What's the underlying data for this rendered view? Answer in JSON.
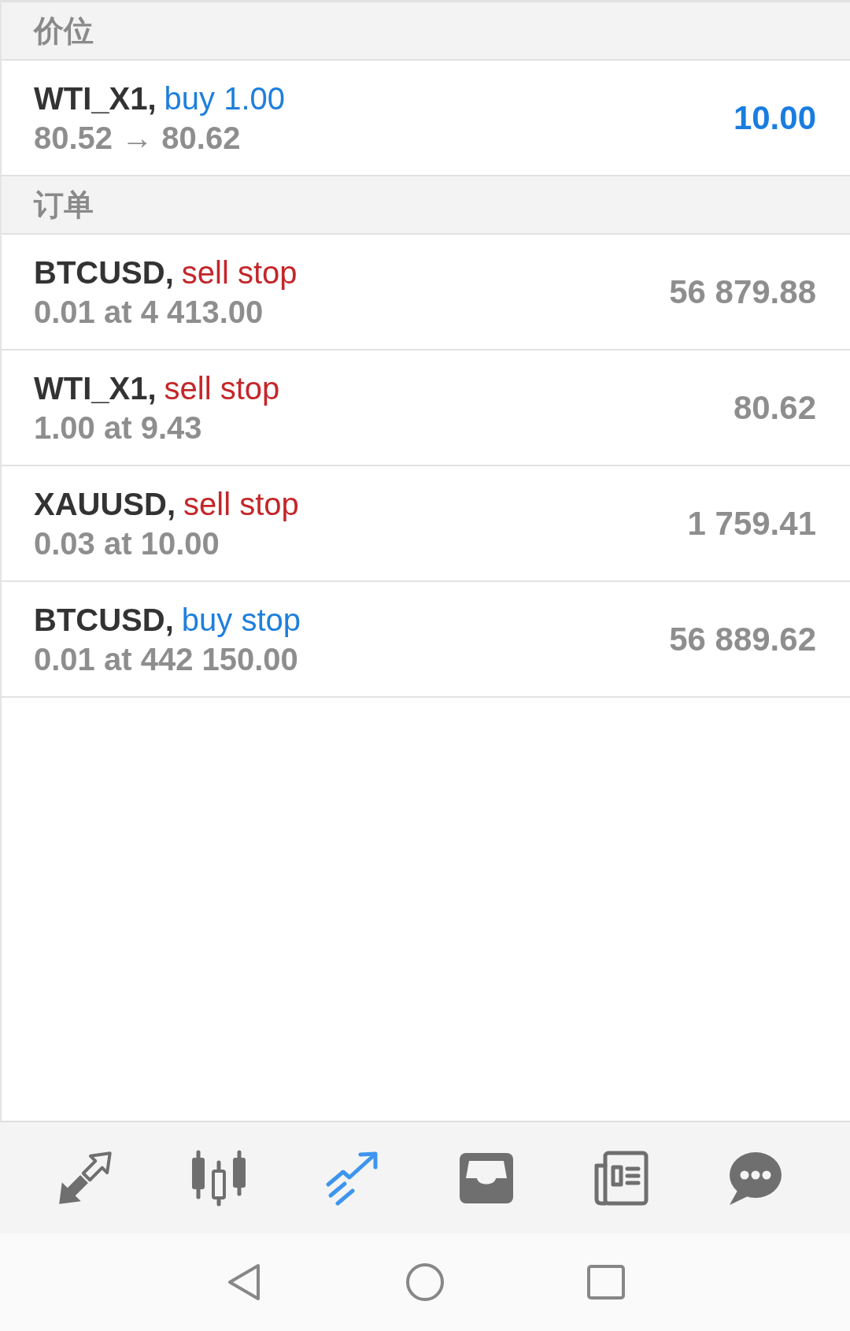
{
  "sections": [
    {
      "title": "价位",
      "items": [
        {
          "symbol": "WTI_X1,",
          "type": "buy 1.00",
          "kind": "buy",
          "detail": "80.52 → 80.62",
          "value": "10.00",
          "highlighted": true
        }
      ]
    },
    {
      "title": "订单",
      "items": [
        {
          "symbol": "BTCUSD,",
          "type": "sell stop",
          "kind": "sell",
          "detail": "0.01 at 4 413.00",
          "value": "56 879.88",
          "highlighted": false
        },
        {
          "symbol": "WTI_X1,",
          "type": "sell stop",
          "kind": "sell",
          "detail": "1.00 at 9.43",
          "value": "80.62",
          "highlighted": false
        },
        {
          "symbol": "XAUUSD,",
          "type": "sell stop",
          "kind": "sell",
          "detail": "0.03 at 10.00",
          "value": "1 759.41",
          "highlighted": false
        },
        {
          "symbol": "BTCUSD,",
          "type": "buy stop",
          "kind": "buy",
          "detail": "0.01 at 442 150.00",
          "value": "56 889.62",
          "highlighted": false
        }
      ]
    }
  ],
  "tab_bar": {
    "tabs": [
      {
        "kind": "arrows",
        "selected": false
      },
      {
        "kind": "candles",
        "selected": false
      },
      {
        "kind": "trend",
        "selected": true
      },
      {
        "kind": "inbox",
        "selected": false
      },
      {
        "kind": "newspaper",
        "selected": false
      },
      {
        "kind": "chat",
        "selected": false
      }
    ]
  },
  "nav_bar": {
    "buttons": [
      {
        "kind": "back"
      },
      {
        "kind": "home"
      },
      {
        "kind": "recents"
      }
    ]
  }
}
